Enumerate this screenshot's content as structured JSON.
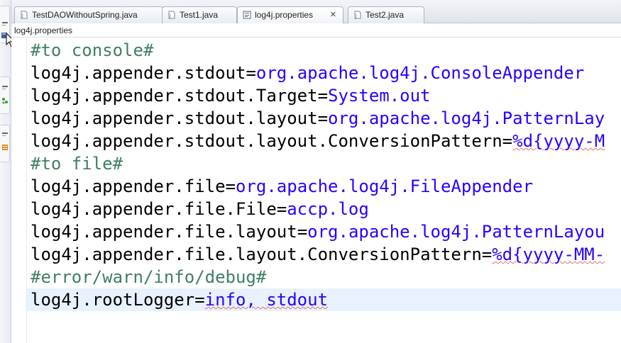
{
  "tabs": [
    {
      "label": "TestDAOWithoutSpring.java",
      "icon": "java-file-icon",
      "active": false,
      "closable": false
    },
    {
      "label": "Test1.java",
      "icon": "java-file-icon",
      "active": false,
      "closable": false
    },
    {
      "label": "log4j.properties",
      "icon": "properties-file-icon",
      "active": true,
      "closable": true,
      "close_glyph": "✕"
    },
    {
      "label": "Test2.java",
      "icon": "java-file-icon",
      "active": false,
      "closable": false
    }
  ],
  "breadcrumb": "log4j.properties",
  "editor": {
    "lines": [
      {
        "key": "#to console#",
        "sep": "",
        "value": "",
        "comment": true
      },
      {
        "key": "log4j.appender.stdout",
        "sep": "=",
        "value": "org.apache.log4j.ConsoleAppender",
        "comment": false
      },
      {
        "key": "log4j.appender.stdout.Target",
        "sep": "=",
        "value": "System.out",
        "comment": false
      },
      {
        "key": "log4j.appender.stdout.layout",
        "sep": "=",
        "value": "org.apache.log4j.PatternLay",
        "comment": false
      },
      {
        "key": "log4j.appender.stdout.layout.ConversionPattern",
        "sep": "=",
        "value": "%d{yyyy-M",
        "comment": false
      },
      {
        "key": "#to file#",
        "sep": "",
        "value": "",
        "comment": true
      },
      {
        "key": "log4j.appender.file",
        "sep": "=",
        "value": "org.apache.log4j.FileAppender",
        "comment": false
      },
      {
        "key": "log4j.appender.file.File",
        "sep": "=",
        "value": "accp.log",
        "comment": false
      },
      {
        "key": "log4j.appender.file.layout",
        "sep": "=",
        "value": "org.apache.log4j.PatternLayou",
        "comment": false
      },
      {
        "key": "log4j.appender.file.layout.ConversionPattern",
        "sep": "=",
        "value": "%d{yyyy-MM-",
        "comment": false
      },
      {
        "key": "#error/warn/info/debug#",
        "sep": "",
        "value": "",
        "comment": true
      },
      {
        "key": "log4j.rootLogger",
        "sep": "=",
        "value": "info, stdout",
        "comment": false
      }
    ]
  },
  "colors": {
    "comment": "#3f7f5f",
    "value": "#2a00ff",
    "key": "#000000",
    "current_line": "#e8f2fe"
  }
}
